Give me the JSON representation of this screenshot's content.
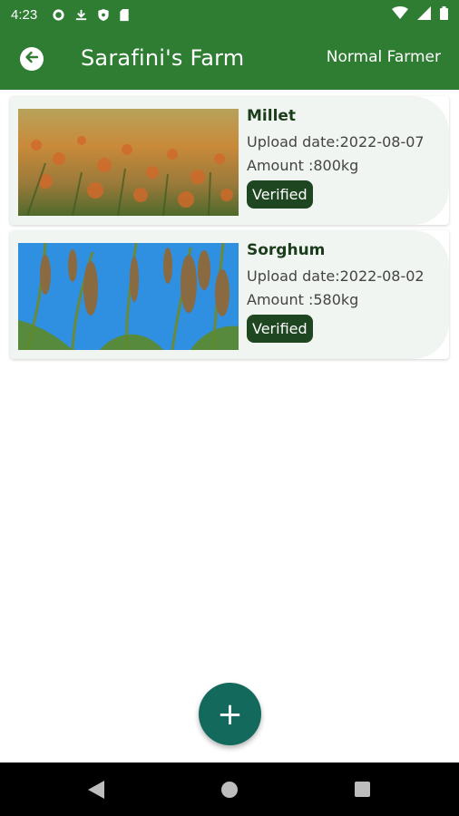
{
  "status_bar": {
    "time": "4:23",
    "left_icons": [
      "gear-icon",
      "download-icon",
      "shield-icon",
      "sd-card-icon"
    ],
    "right_icons": [
      "wifi-icon",
      "signal-icon",
      "battery-icon"
    ]
  },
  "app_bar": {
    "back_icon": "back-arrow-icon",
    "title": "Sarafini's Farm",
    "role": "Normal Farmer"
  },
  "crops": [
    {
      "name": "Millet",
      "upload_label": "Upload date:",
      "upload_date": "2022-08-07",
      "amount_label": "Amount :",
      "amount": "800kg",
      "status": "Verified"
    },
    {
      "name": "Sorghum",
      "upload_label": "Upload date:",
      "upload_date": "2022-08-02",
      "amount_label": "Amount :",
      "amount": "580kg",
      "status": "Verified"
    }
  ],
  "fab": {
    "icon": "plus-icon",
    "label": "+"
  },
  "colors": {
    "primary": "#2e7d32",
    "badge": "#1e4620",
    "fab": "#136a5c"
  }
}
